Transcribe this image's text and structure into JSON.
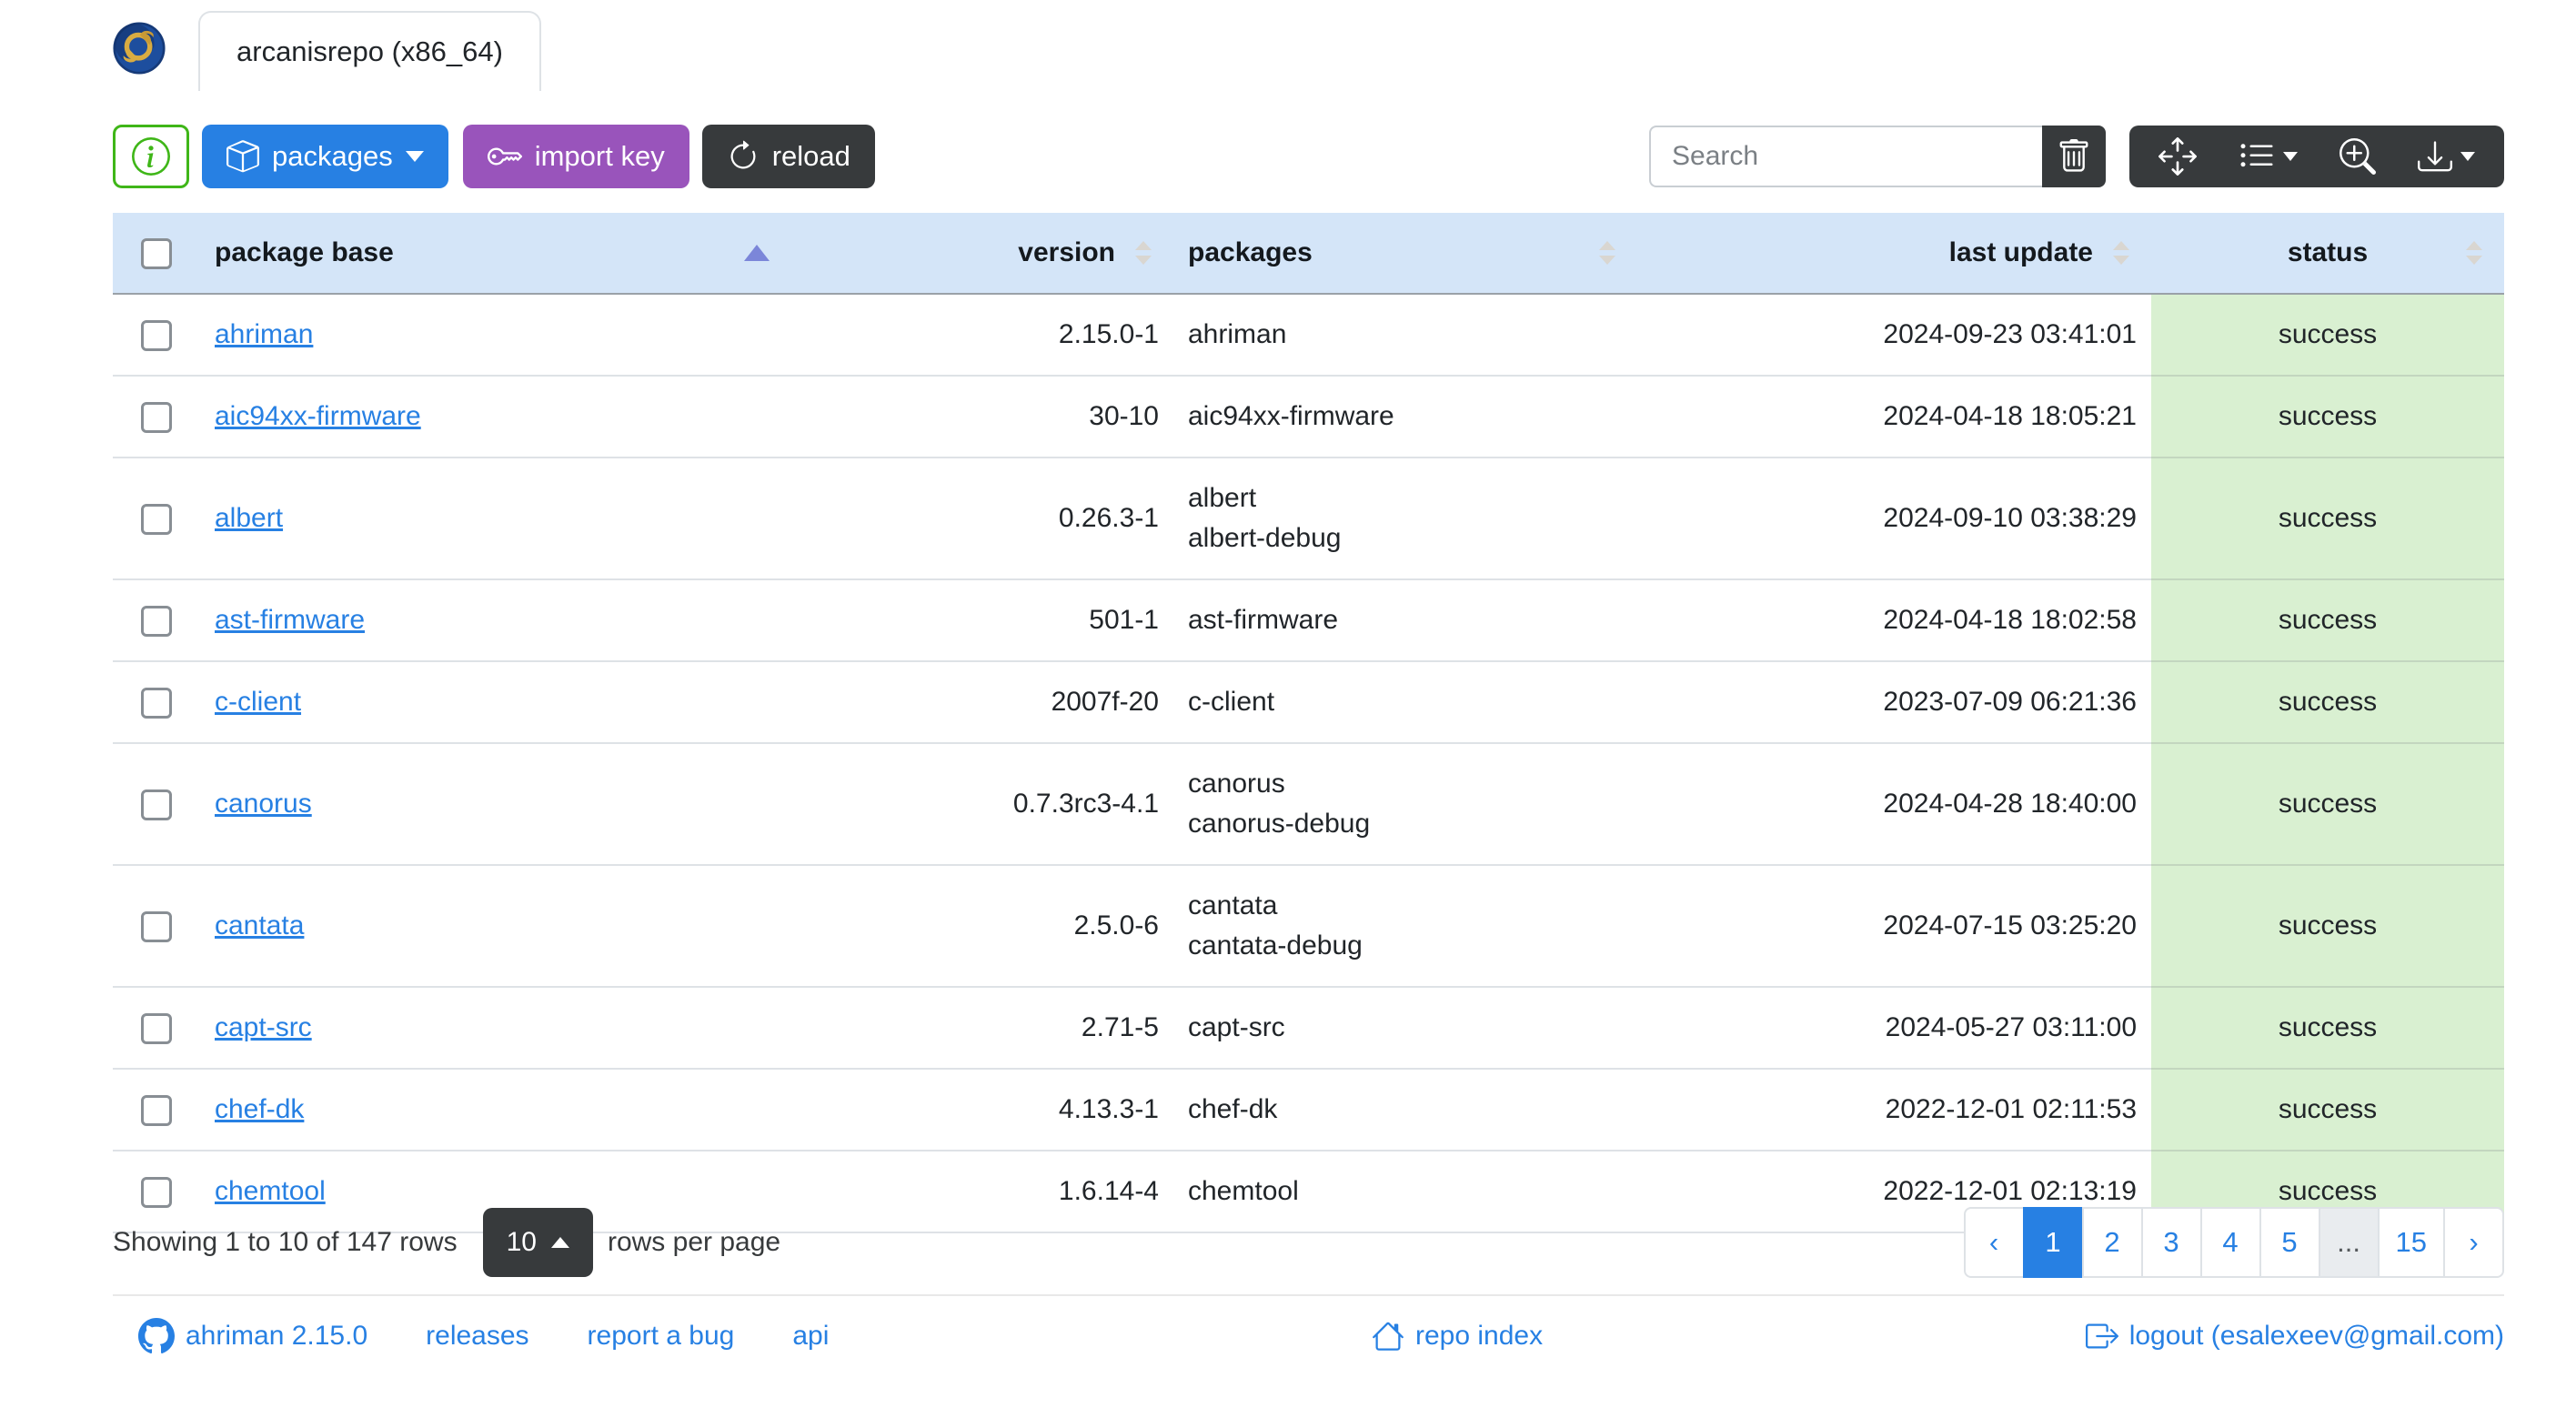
{
  "header": {
    "tab_label": "arcanisrepo (x86_64)"
  },
  "toolbar": {
    "packages_label": "packages",
    "import_key_label": "import key",
    "reload_label": "reload",
    "search_placeholder": "Search"
  },
  "icons": [
    "app-logo",
    "info-circle-icon",
    "box-icon",
    "caret-down-icon",
    "key-icon",
    "reload-icon",
    "trash-icon",
    "arrows-move-icon",
    "list-icon",
    "zoom-in-icon",
    "download-icon",
    "caret-up-icon",
    "github-icon",
    "house-icon",
    "logout-icon",
    "sort-ascending-icon",
    "sort-both-icon"
  ],
  "table": {
    "columns": [
      "package base",
      "version",
      "packages",
      "last update",
      "status"
    ],
    "rows": [
      {
        "base": "ahriman",
        "version": "2.15.0-1",
        "packages": [
          "ahriman"
        ],
        "last_update": "2024-09-23 03:41:01",
        "status": "success"
      },
      {
        "base": "aic94xx-firmware",
        "version": "30-10",
        "packages": [
          "aic94xx-firmware"
        ],
        "last_update": "2024-04-18 18:05:21",
        "status": "success"
      },
      {
        "base": "albert",
        "version": "0.26.3-1",
        "packages": [
          "albert",
          "albert-debug"
        ],
        "last_update": "2024-09-10 03:38:29",
        "status": "success"
      },
      {
        "base": "ast-firmware",
        "version": "501-1",
        "packages": [
          "ast-firmware"
        ],
        "last_update": "2024-04-18 18:02:58",
        "status": "success"
      },
      {
        "base": "c-client",
        "version": "2007f-20",
        "packages": [
          "c-client"
        ],
        "last_update": "2023-07-09 06:21:36",
        "status": "success"
      },
      {
        "base": "canorus",
        "version": "0.7.3rc3-4.1",
        "packages": [
          "canorus",
          "canorus-debug"
        ],
        "last_update": "2024-04-28 18:40:00",
        "status": "success"
      },
      {
        "base": "cantata",
        "version": "2.5.0-6",
        "packages": [
          "cantata",
          "cantata-debug"
        ],
        "last_update": "2024-07-15 03:25:20",
        "status": "success"
      },
      {
        "base": "capt-src",
        "version": "2.71-5",
        "packages": [
          "capt-src"
        ],
        "last_update": "2024-05-27 03:11:00",
        "status": "success"
      },
      {
        "base": "chef-dk",
        "version": "4.13.3-1",
        "packages": [
          "chef-dk"
        ],
        "last_update": "2022-12-01 02:11:53",
        "status": "success"
      },
      {
        "base": "chemtool",
        "version": "1.6.14-4",
        "packages": [
          "chemtool"
        ],
        "last_update": "2022-12-01 02:13:19",
        "status": "success"
      }
    ]
  },
  "pagination": {
    "summary": "Showing 1 to 10 of 147 rows",
    "page_size": "10",
    "rows_per_page_label": "rows per page",
    "prev_label": "‹",
    "next_label": "›",
    "pages": [
      "1",
      "2",
      "3",
      "4",
      "5",
      "...",
      "15"
    ],
    "active_page": "1",
    "ellipsis": "..."
  },
  "footer": {
    "version_link": "ahriman 2.15.0",
    "releases_link": "releases",
    "report_bug_link": "report a bug",
    "api_link": "api",
    "repo_index_link": "repo index",
    "logout_link": "logout (esalexeev@gmail.com)"
  },
  "colors": {
    "accent_blue": "#2780e3",
    "purple": "#9954bb",
    "dark": "#373a3c",
    "success_green": "#3fb618",
    "table_header_bg": "#d4e5f8",
    "status_cell_bg": "#d9f0d1",
    "sort_active": "#7b86d9"
  }
}
